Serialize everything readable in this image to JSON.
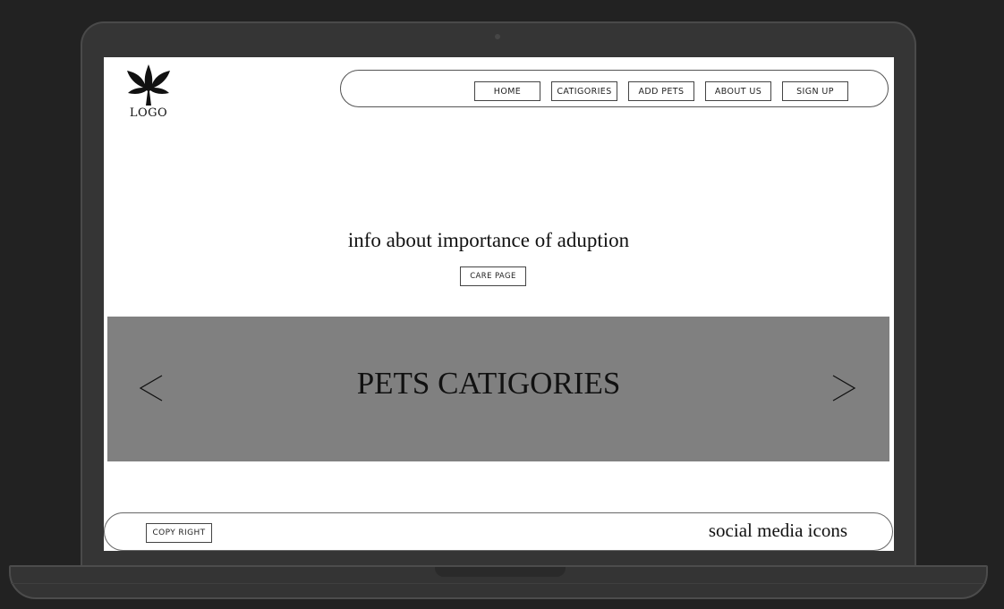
{
  "logo": {
    "icon": "leaf-icon",
    "text": "LOGO"
  },
  "nav": {
    "items": [
      "HOME",
      "CATIGORIES",
      "ADD PETS",
      "ABOUT US",
      "SIGN UP"
    ]
  },
  "hero": {
    "info_text": "info about importance of aduption",
    "care_button": "CARE PAGE"
  },
  "banner": {
    "title": "PETS CATIGORIES",
    "prev_arrow": "<",
    "next_arrow": ">",
    "background_color": "#808080"
  },
  "footer": {
    "copyright_label": "COPY RIGHT",
    "social_text": "social media icons"
  }
}
